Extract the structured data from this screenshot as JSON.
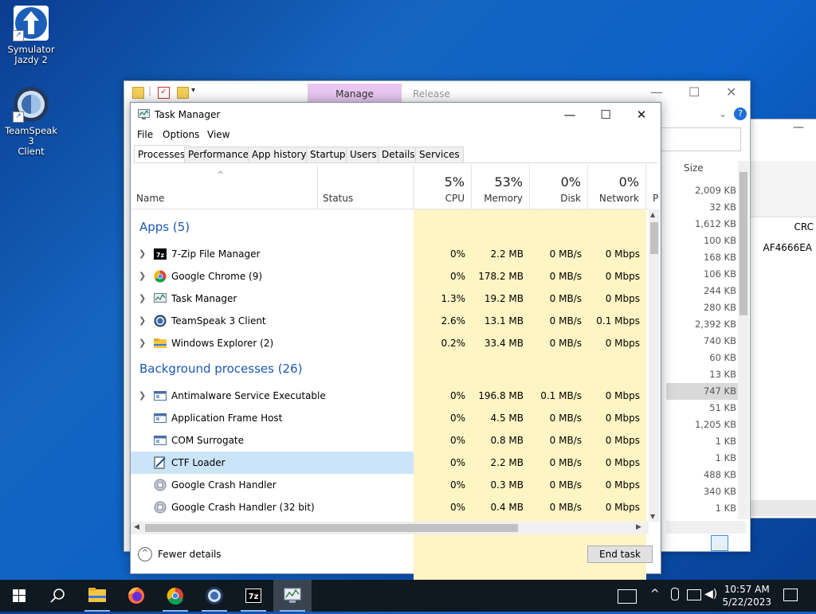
{
  "desktop": {
    "icons": [
      {
        "label_line1": "Symulator",
        "label_line2": "Jazdy 2"
      },
      {
        "label_line1": "TeamSpeak 3",
        "label_line2": "Client"
      }
    ]
  },
  "explorer": {
    "manage_tab": "Manage",
    "release_tab": "Release",
    "size_header": "Size",
    "crc_header": "CRC",
    "crc_value": "AF4666EA",
    "sizes": [
      "2,009 KB",
      "32 KB",
      "1,612 KB",
      "100 KB",
      "168 KB",
      "106 KB",
      "244 KB",
      "280 KB",
      "2,392 KB",
      "740 KB",
      "60 KB",
      "13 KB",
      "747 KB",
      "51 KB",
      "1,205 KB",
      "1 KB",
      "1 KB",
      "488 KB",
      "340 KB",
      "1 KB"
    ],
    "selected_size_index": 12
  },
  "taskmanager": {
    "title": "Task Manager",
    "menu": {
      "file": "File",
      "options": "Options",
      "view": "View"
    },
    "tabs": [
      "Processes",
      "Performance",
      "App history",
      "Startup",
      "Users",
      "Details",
      "Services"
    ],
    "active_tab": "Processes",
    "header": {
      "name": "Name",
      "status": "Status",
      "cpu_pct": "5%",
      "cpu": "CPU",
      "mem_pct": "53%",
      "mem": "Memory",
      "disk_pct": "0%",
      "disk": "Disk",
      "net_pct": "0%",
      "net": "Network",
      "power_partial": "P"
    },
    "groups": {
      "apps": "Apps (5)",
      "background": "Background processes (26)"
    },
    "apps": [
      {
        "name": "7-Zip File Manager",
        "cpu": "0%",
        "mem": "2.2 MB",
        "disk": "0 MB/s",
        "net": "0 Mbps",
        "icon": "7zip-icon"
      },
      {
        "name": "Google Chrome (9)",
        "cpu": "0%",
        "mem": "178.2 MB",
        "disk": "0 MB/s",
        "net": "0 Mbps",
        "icon": "chrome-icon"
      },
      {
        "name": "Task Manager",
        "cpu": "1.3%",
        "mem": "19.2 MB",
        "disk": "0 MB/s",
        "net": "0 Mbps",
        "icon": "taskmanager-icon"
      },
      {
        "name": "TeamSpeak 3 Client",
        "cpu": "2.6%",
        "mem": "13.1 MB",
        "disk": "0 MB/s",
        "net": "0.1 Mbps",
        "icon": "teamspeak-icon"
      },
      {
        "name": "Windows Explorer (2)",
        "cpu": "0.2%",
        "mem": "33.4 MB",
        "disk": "0 MB/s",
        "net": "0 Mbps",
        "icon": "folder-icon"
      }
    ],
    "background": [
      {
        "name": "Antimalware Service Executable",
        "cpu": "0%",
        "mem": "196.8 MB",
        "disk": "0.1 MB/s",
        "net": "0 Mbps",
        "icon": "service-icon"
      },
      {
        "name": "Application Frame Host",
        "cpu": "0%",
        "mem": "4.5 MB",
        "disk": "0 MB/s",
        "net": "0 Mbps",
        "icon": "service-icon"
      },
      {
        "name": "COM Surrogate",
        "cpu": "0%",
        "mem": "0.8 MB",
        "disk": "0 MB/s",
        "net": "0 Mbps",
        "icon": "service-icon"
      },
      {
        "name": "CTF Loader",
        "cpu": "0%",
        "mem": "2.2 MB",
        "disk": "0 MB/s",
        "net": "0 Mbps",
        "icon": "ctf-icon"
      },
      {
        "name": "Google Crash Handler",
        "cpu": "0%",
        "mem": "0.3 MB",
        "disk": "0 MB/s",
        "net": "0 Mbps",
        "icon": "crash-handler-icon"
      },
      {
        "name": "Google Crash Handler (32 bit)",
        "cpu": "0%",
        "mem": "0.4 MB",
        "disk": "0 MB/s",
        "net": "0 Mbps",
        "icon": "crash-handler-icon"
      }
    ],
    "footer": {
      "fewer_details": "Fewer details",
      "end_task": "End task"
    }
  },
  "taskbar": {
    "time": "10:57 AM",
    "date": "5/22/2023"
  }
}
